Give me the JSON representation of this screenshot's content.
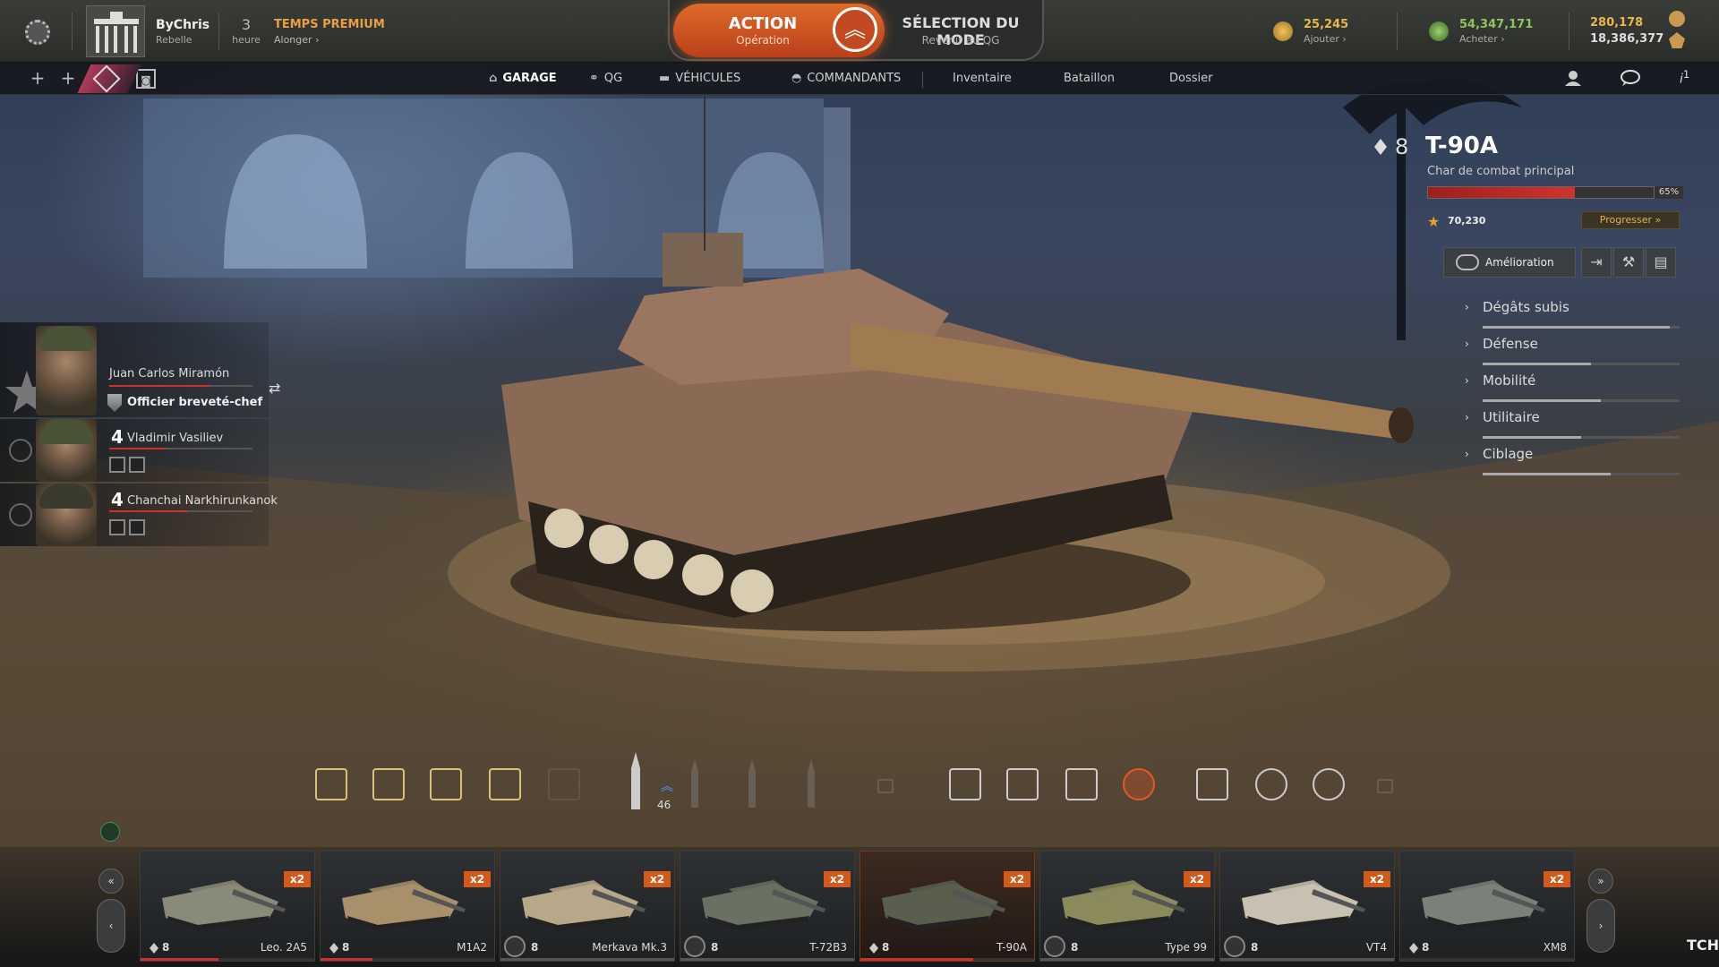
{
  "player": {
    "name": "ByChris",
    "subtitle": "Rebelle"
  },
  "premium": {
    "amount": "3",
    "unit": "heure",
    "title": "TEMPS PREMIUM",
    "link": "Alonger"
  },
  "mode": {
    "action_label": "ACTION",
    "action_sub": "Opération",
    "select_label": "SÉLECTION DU MODE",
    "select_sub": "Revenir au QG"
  },
  "currencies": {
    "gold": {
      "value": "25,245",
      "link": "Ajouter",
      "color": "#e8b84a"
    },
    "credits": {
      "value": "54,347,171",
      "link": "Acheter",
      "color": "#8fc460"
    },
    "xp_top": {
      "value": "280,178",
      "color": "#e8b84a"
    },
    "xp_bottom": {
      "value": "18,386,377",
      "color": "#dddddd"
    }
  },
  "nav": {
    "items": [
      {
        "label": "GARAGE",
        "icon": "garage-icon"
      },
      {
        "label": "QG",
        "icon": "hq-nodes-icon"
      },
      {
        "label": "VÉHICULES",
        "icon": "tank-icon"
      },
      {
        "label": "COMMANDANTS",
        "icon": "helmet-icon"
      },
      {
        "label": "Inventaire"
      },
      {
        "label": "Bataillon"
      },
      {
        "label": "Dossier"
      }
    ],
    "info_count": "1"
  },
  "crew": [
    {
      "name": "Juan Carlos Miramón",
      "rank": "Officier breveté-chef",
      "level": ""
    },
    {
      "name": "Vladimir Vasiliev",
      "level": "4"
    },
    {
      "name": "Chanchai Narkhirunkanok",
      "level": "4"
    }
  ],
  "vehicle": {
    "tier": "8",
    "name": "T-90A",
    "class": "Char de combat principal",
    "progress_pct": "65%",
    "progress_value": 0.65,
    "xp": "70,230",
    "progress_btn": "Progresser",
    "upgrade_btn": "Amélioration",
    "stats": [
      {
        "label": "Dégâts subis",
        "level": 0.95
      },
      {
        "label": "Défense",
        "level": 0.55
      },
      {
        "label": "Mobilité",
        "level": 0.6
      },
      {
        "label": "Utilitaire",
        "level": 0.5
      },
      {
        "label": "Ciblage",
        "level": 0.65
      }
    ]
  },
  "ammo": {
    "count": "46"
  },
  "carousel": {
    "cards": [
      {
        "name": "Leo. 2A5",
        "tier": "8",
        "mult": "x2",
        "progress": 0.45,
        "elite": false
      },
      {
        "name": "M1A2",
        "tier": "8",
        "mult": "x2",
        "progress": 0.3,
        "elite": false
      },
      {
        "name": "Merkava Mk.3",
        "tier": "8",
        "mult": "x2",
        "progress": 1.0,
        "elite": true
      },
      {
        "name": "T-72B3",
        "tier": "8",
        "mult": "x2",
        "progress": 1.0,
        "elite": true
      },
      {
        "name": "T-90A",
        "tier": "8",
        "mult": "x2",
        "progress": 0.65,
        "elite": false
      },
      {
        "name": "Type 99",
        "tier": "8",
        "mult": "x2",
        "progress": 1.0,
        "elite": true
      },
      {
        "name": "VT4",
        "tier": "8",
        "mult": "x2",
        "progress": 1.0,
        "elite": true
      },
      {
        "name": "XM8",
        "tier": "8",
        "mult": "x2",
        "progress": 0.0,
        "elite": false
      }
    ],
    "trailing_text": "TCHA"
  }
}
